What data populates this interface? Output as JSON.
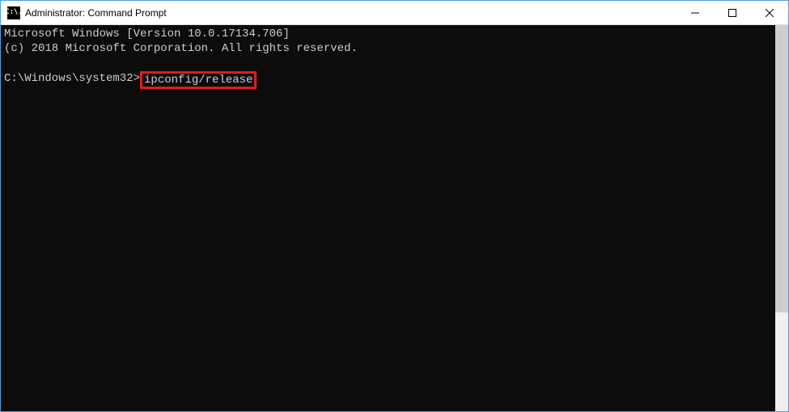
{
  "window": {
    "title": "Administrator: Command Prompt",
    "icon_text": "C:\\."
  },
  "console": {
    "line1": "Microsoft Windows [Version 10.0.17134.706]",
    "line2": "(c) 2018 Microsoft Corporation. All rights reserved.",
    "blank": "",
    "prompt": "C:\\Windows\\system32>",
    "command": "ipconfig/release"
  },
  "highlight": {
    "color": "#e31b1b"
  }
}
